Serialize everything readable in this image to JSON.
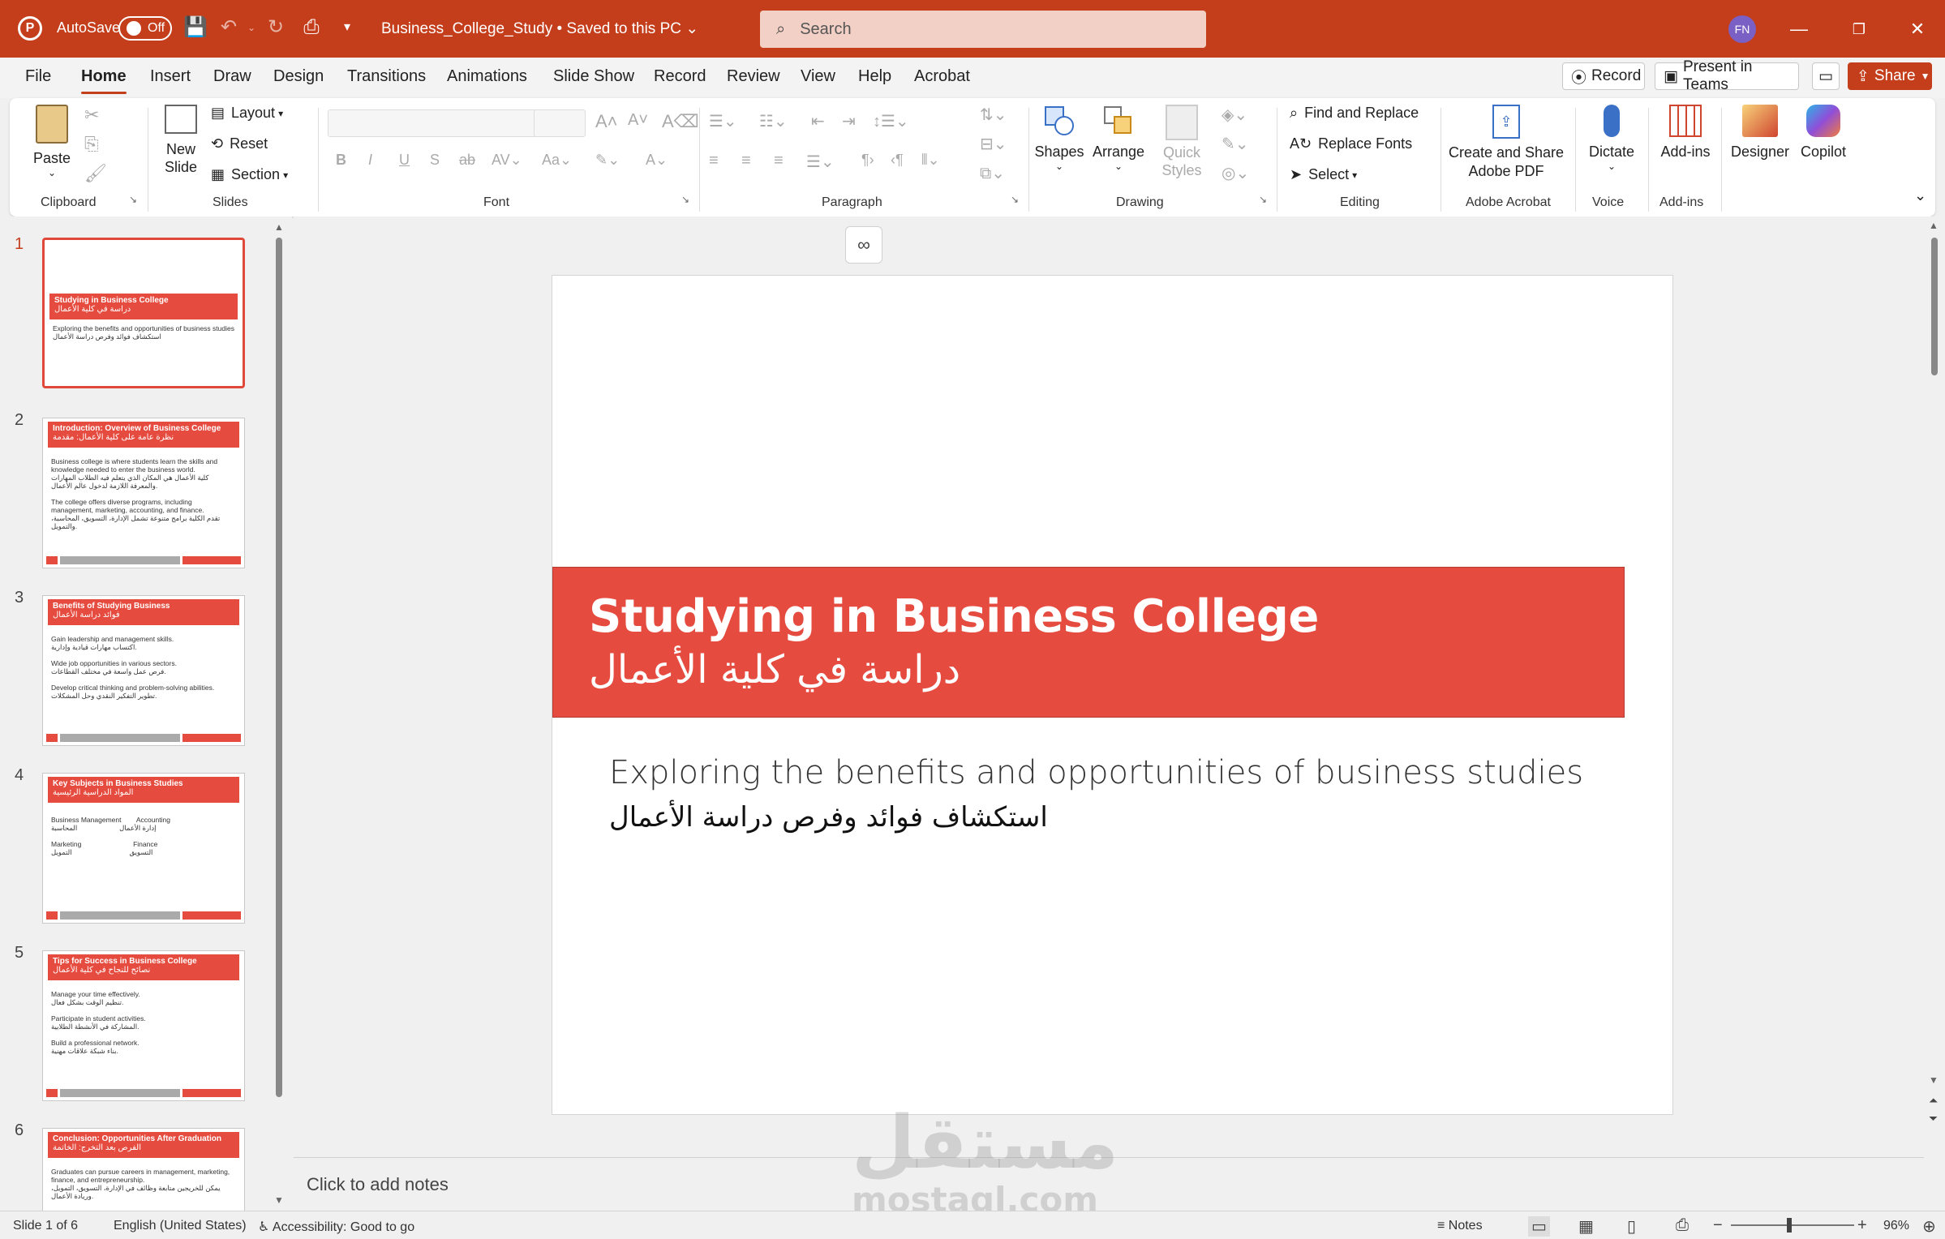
{
  "titlebar": {
    "autosave_label": "AutoSave",
    "autosave_state": "Off",
    "doc_title": "Business_College_Study • Saved to this PC",
    "search_placeholder": "Search",
    "avatar_initials": "FN",
    "accent_color": "#c43e1c"
  },
  "menu": {
    "tabs": [
      "File",
      "Home",
      "Insert",
      "Draw",
      "Design",
      "Transitions",
      "Animations",
      "Slide Show",
      "Record",
      "Review",
      "View",
      "Help",
      "Acrobat"
    ],
    "active_tab": "Home",
    "record_btn": "Record",
    "present_btn": "Present in Teams",
    "share_btn": "Share"
  },
  "ribbon": {
    "clipboard": {
      "paste": "Paste",
      "label": "Clipboard"
    },
    "slides": {
      "new_slide": "New Slide",
      "layout": "Layout",
      "reset": "Reset",
      "section": "Section",
      "label": "Slides"
    },
    "font": {
      "label": "Font"
    },
    "paragraph": {
      "label": "Paragraph"
    },
    "drawing": {
      "shapes": "Shapes",
      "arrange": "Arrange",
      "quick_styles": "Quick Styles",
      "label": "Drawing"
    },
    "editing": {
      "find_replace": "Find and Replace",
      "replace_fonts": "Replace Fonts",
      "select": "Select",
      "label": "Editing"
    },
    "acrobat": {
      "create_share": "Create and Share Adobe PDF",
      "label": "Adobe Acrobat"
    },
    "voice": {
      "dictate": "Dictate",
      "label": "Voice"
    },
    "addins": {
      "addins": "Add-ins",
      "label": "Add-ins"
    },
    "designer": "Designer",
    "copilot": "Copilot"
  },
  "thumbnails": [
    {
      "num": "1",
      "title": "Studying in Business College",
      "subtitle": "دراسة في كلية الأعمال",
      "body": "Exploring the benefits and opportunities of business studies\nاستكشاف فوائد وفرص دراسة الأعمال"
    },
    {
      "num": "2",
      "title": "Introduction: Overview of Business College",
      "subtitle": "نظرة عامة على كلية الأعمال: مقدمة",
      "body": "Business college is where students learn the skills and knowledge needed to enter the business world.\nكلية الأعمال هي المكان الذي يتعلم فيه الطلاب المهارات والمعرفة اللازمة لدخول عالم الأعمال.\n\nThe college offers diverse programs, including management, marketing, accounting, and finance.\nتقدم الكلية برامج متنوعة تشمل الإدارة، التسويق، المحاسبة، والتمويل."
    },
    {
      "num": "3",
      "title": "Benefits of Studying Business",
      "subtitle": "فوائد دراسة الأعمال",
      "body": "Gain leadership and management skills.\nاكتساب مهارات قيادية وإدارية.\n\nWide job opportunities in various sectors.\nفرص عمل واسعة في مختلف القطاعات.\n\nDevelop critical thinking and problem-solving abilities.\nتطوير التفكير النقدي وحل المشكلات."
    },
    {
      "num": "4",
      "title": "Key Subjects in Business Studies",
      "subtitle": "المواد الدراسية الرئيسية",
      "body": "Business Management        Accounting\nإدارة الأعمال                      المحاسبة\n\nMarketing                           Finance\nالتسويق                              التمويل"
    },
    {
      "num": "5",
      "title": "Tips for Success in Business College",
      "subtitle": "نصائح للنجاح في كلية الأعمال",
      "body": "Manage your time effectively.\nتنظيم الوقت بشكل فعال.\n\nParticipate in student activities.\nالمشاركة في الأنشطة الطلابية.\n\nBuild a professional network.\nبناء شبكة علاقات مهنية."
    },
    {
      "num": "6",
      "title": "Conclusion: Opportunities After Graduation",
      "subtitle": "الفرص بعد التخرج: الخاتمة",
      "body": "Graduates can pursue careers in management, marketing, finance, and entrepreneurship.\nيمكن للخريجين متابعة وظائف في الإدارة، التسويق، التمويل، وريادة الأعمال."
    }
  ],
  "slide": {
    "title_en": "Studying in Business College",
    "title_ar": "دراسة في كلية الأعمال",
    "subtitle_en": "Exploring the benefits and opportunities of business studies",
    "subtitle_ar": "استكشاف فوائد وفرص دراسة الأعمال",
    "title_bar_color": "#e54b3f"
  },
  "notes": {
    "placeholder": "Click to add notes"
  },
  "watermark": {
    "ar": "مستقل",
    "en": "mostaql.com"
  },
  "statusbar": {
    "slide_info": "Slide 1 of 6",
    "language": "English (United States)",
    "accessibility": "Accessibility: Good to go",
    "notes": "Notes",
    "zoom": "96%"
  }
}
